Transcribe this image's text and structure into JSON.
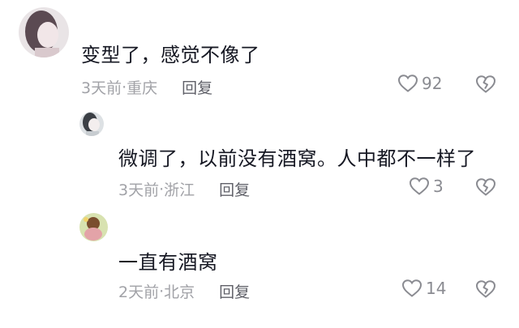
{
  "comments": [
    {
      "text": "变型了，感觉不像了",
      "time": "3天前",
      "location": "重庆",
      "meta_separator": " · ",
      "reply_label": "回复",
      "likes": "92",
      "avatar_icon": "user-avatar-icon",
      "reply": false
    },
    {
      "text": "微调了，以前没有酒窝。人中都不一样了",
      "time": "3天前",
      "location": "浙江",
      "meta_separator": "·",
      "reply_label": "回复",
      "likes": "3",
      "avatar_icon": "user-avatar-icon",
      "reply": true
    },
    {
      "text": "一直有酒窝",
      "time": "2天前",
      "location": "北京",
      "meta_separator": "·",
      "reply_label": "回复",
      "likes": "14",
      "avatar_icon": "user-avatar-icon",
      "reply": true
    }
  ],
  "colors": {
    "text": "#161823",
    "meta": "#a1a2a7",
    "reply": "#5f6068",
    "icon": "#8a8b91"
  },
  "icons": {
    "like": "heart-outline-icon",
    "dislike": "broken-heart-icon"
  }
}
